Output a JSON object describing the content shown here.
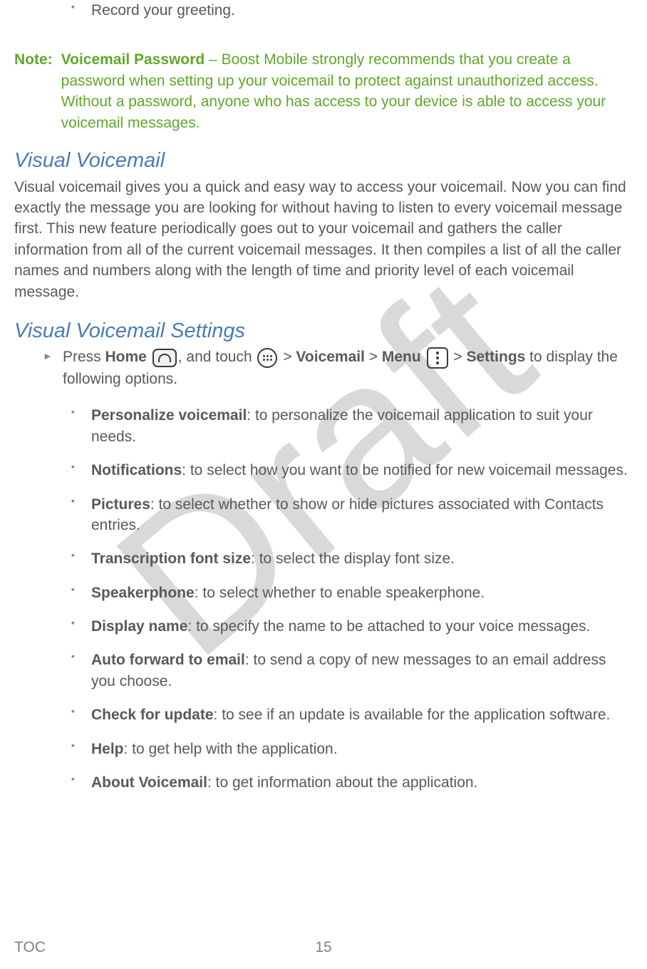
{
  "watermark": "Draft",
  "top_bullet": "Record your greeting.",
  "note": {
    "label": "Note:",
    "title": "Voicemail Password",
    "sep": " – ",
    "body": "Boost Mobile strongly recommends that you create a password when setting up your voicemail to protect against unauthorized access. Without a password, anyone who has access to your device is able to access your voicemail messages."
  },
  "section1": {
    "heading": "Visual Voicemail",
    "body": "Visual voicemail gives you a quick and easy way to access your voicemail. Now you can find exactly the message you are looking for without having to listen to every voicemail message first. This new feature periodically goes out to your voicemail and gathers the caller information from all of the current voicemail messages. It then compiles a list of all the caller names and numbers along with the length of time and priority level of each voicemail message."
  },
  "section2": {
    "heading": "Visual Voicemail Settings",
    "intro": {
      "p1": "Press ",
      "home": "Home",
      "p2": ", and touch ",
      "gt1": " > ",
      "voicemail": "Voicemail",
      "gt2": " > ",
      "menu": "Menu",
      "gt3": " > ",
      "settings": "Settings",
      "p3": " to display the following options."
    },
    "options": [
      {
        "name": "Personalize voicemail",
        "desc": ": to personalize the voicemail application to suit your needs."
      },
      {
        "name": "Notifications",
        "desc": ": to select how you want to be notified for new voicemail messages."
      },
      {
        "name": "Pictures",
        "desc": ": to select whether to show or hide pictures associated with Contacts entries."
      },
      {
        "name": "Transcription font size",
        "desc": ": to select the display font size."
      },
      {
        "name": "Speakerphone",
        "desc": ": to select whether to enable speakerphone."
      },
      {
        "name": "Display name",
        "desc": ": to specify the name to be attached to your voice messages."
      },
      {
        "name": "Auto forward to email",
        "desc": ": to send a copy of new messages to an email address you choose."
      },
      {
        "name": "Check for update",
        "desc": ": to see if an update is available for the application software."
      },
      {
        "name": "Help",
        "desc": ": to get help with the application."
      },
      {
        "name": "About Voicemail",
        "desc": ": to get information about the application."
      }
    ]
  },
  "footer": {
    "toc": "TOC",
    "page": "15"
  }
}
